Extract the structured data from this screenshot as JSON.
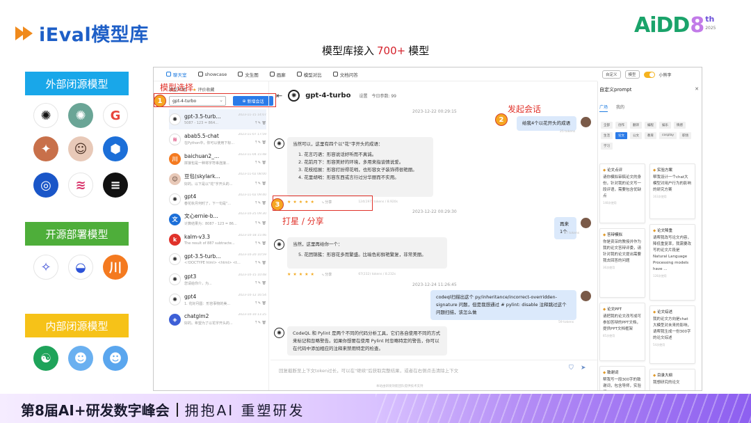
{
  "slide": {
    "title": "iEval模型库",
    "subtitle_pre": "模型库接入",
    "subtitle_count": "700+",
    "subtitle_post": "模型",
    "brand_word": "AiDD",
    "brand_num": "8",
    "brand_sup": "th",
    "brand_year": "2025",
    "accent": "#1e5fc7",
    "red": "#d4202a"
  },
  "categories": {
    "closed_external": "外部闭源模型",
    "open_deployed": "开源部署模型",
    "closed_internal": "内部闭源模型"
  },
  "logos": {
    "closed_external": [
      {
        "icon": "openai-icon",
        "glyph": "✺",
        "bg": "#ffffff",
        "fg": "#111111"
      },
      {
        "icon": "chatgpt-icon",
        "glyph": "✺",
        "bg": "#6aa596",
        "fg": "#ffffff"
      },
      {
        "icon": "google-icon",
        "glyph": "G",
        "bg": "#ffffff",
        "fg": "#e8453c"
      },
      {
        "icon": "claude-icon",
        "glyph": "✦",
        "bg": "#c8704a",
        "fg": "#ffffff"
      },
      {
        "icon": "avatar-girl-icon",
        "glyph": "☺",
        "bg": "#e8c9b8",
        "fg": "#4a3024"
      },
      {
        "icon": "hexagon-model-icon",
        "glyph": "⬢",
        "bg": "#1c6fd8",
        "fg": "#ffffff"
      },
      {
        "icon": "ring-model-icon",
        "glyph": "◎",
        "bg": "#1a56c8",
        "fg": "#ffffff"
      },
      {
        "icon": "wave-model-icon",
        "glyph": "≋",
        "bg": "#ffffff",
        "fg": "#d8336a"
      },
      {
        "icon": "stripe-model-icon",
        "glyph": "≡",
        "bg": "#111111",
        "fg": "#ffffff"
      }
    ],
    "open_deployed": [
      {
        "icon": "star-model-icon",
        "glyph": "✧",
        "bg": "#ffffff",
        "fg": "#3d4fd6"
      },
      {
        "icon": "whale-model-icon",
        "glyph": "◒",
        "bg": "#ffffff",
        "fg": "#2c52d8"
      },
      {
        "icon": "baichuan-icon",
        "glyph": "川",
        "bg": "#f47a20",
        "fg": "#ffffff"
      }
    ],
    "closed_internal": [
      {
        "icon": "leaf-model-icon",
        "glyph": "☯",
        "bg": "#1fa35a",
        "fg": "#ffffff"
      },
      {
        "icon": "robot-blue-icon",
        "glyph": "☻",
        "bg": "#6ab0f0",
        "fg": "#ffffff"
      },
      {
        "icon": "robot-blue-2-icon",
        "glyph": "☻",
        "bg": "#5aa6ee",
        "fg": "#ffffff"
      }
    ]
  },
  "app": {
    "nav": [
      {
        "label": "聊天室",
        "active": true
      },
      {
        "label": "showcase",
        "active": false
      },
      {
        "label": "文生图",
        "active": false
      },
      {
        "label": "画廊",
        "active": false
      },
      {
        "label": "模型对比",
        "active": false
      },
      {
        "label": "文档问答",
        "active": false
      }
    ],
    "top_right": {
      "chip1": "自定义",
      "chip2": "模型",
      "user": "小熊李"
    },
    "side_tabs": {
      "declare": "模型声明",
      "fav": "评价收藏"
    },
    "model_select": "gpt-4-turbo",
    "new_chat": "新增会话",
    "sessions": [
      {
        "name": "gpt-3.5-turb...",
        "time": "2023-11-15 14:07",
        "preview": "5087 - 123 = 864...",
        "color": "#ffffff",
        "glyph": "✺",
        "fg": "#222"
      },
      {
        "name": "abab5.5-chat",
        "time": "2023-11-07 17:59",
        "preview": "在Python中，你可以使用下标...",
        "color": "#ffffff",
        "glyph": "≋",
        "fg": "#d8336a"
      },
      {
        "name": "baichuan2_...",
        "time": "2023-11-04 15:48",
        "preview": "拼接包是一种将字符串连接...",
        "color": "#f47a20",
        "glyph": "川",
        "fg": "#fff"
      },
      {
        "name": "豆包(skylark...",
        "time": "2023-11-02 08:00",
        "preview": "好的。以下是以\"花\"字开头的...",
        "color": "#e8c9b8",
        "glyph": "☺",
        "fg": "#4a3024"
      },
      {
        "name": "gpt4",
        "time": "2023-11-02 09:40",
        "preview": "春花秋月何时了，下一句是\"...",
        "color": "#ffffff",
        "glyph": "✺",
        "fg": "#222"
      },
      {
        "name": "文心ernie-b...",
        "time": "2023-10-25 09:30",
        "preview": "计算结果为：8087 - 123 = 86...",
        "color": "#1c6fd8",
        "glyph": "文",
        "fg": "#fff"
      },
      {
        "name": "kalm-v3.3",
        "time": "2023-10-18 15:46",
        "preview": "The result of 887 subtracte...",
        "color": "#e0322a",
        "glyph": "k",
        "fg": "#fff"
      },
      {
        "name": "gpt-3.5-turb...",
        "time": "2023-10-20 10:59",
        "preview": "<!DOCTYPE html> <html> <t...",
        "color": "#ffffff",
        "glyph": "✺",
        "fg": "#222"
      },
      {
        "name": "gpt3",
        "time": "2023-10-15 10:48",
        "preview": "您请给你介，为...",
        "color": "#ffffff",
        "glyph": "✺",
        "fg": "#222"
      },
      {
        "name": "gpt4",
        "time": "2023-10-12 16:54",
        "preview": "1. 花好月圆：形容事物的美...",
        "color": "#ffffff",
        "glyph": "✺",
        "fg": "#222"
      },
      {
        "name": "chatglm2",
        "time": "2023-10-10 11:25",
        "preview": "好的。希望为了以花字开头的...",
        "color": "#3d5fd6",
        "glyph": "◈",
        "fg": "#fff"
      }
    ],
    "chat_title": "gpt-4-turbo",
    "chat_meta": "设置　今日参数: 99",
    "ts1": "2023-12-22 00:29:15",
    "user_msg1": "给我4个以花开头的成语",
    "tok1": "25 tokens",
    "bot_msg1_intro": "当然可以，这里有四个以\"花\"字开头的成语：",
    "bot_msg1_items": [
      "1. 花言巧语：形容说话好听而不真诚。",
      "2. 花前月下：形容美好的环境，多用来指谈情说爱。",
      "3. 花枝招展：形容打扮得花哨，也形容女子装饰得很艳丽。",
      "4. 花里胡哨：形容东西或言行过分华丽而不实用。"
    ],
    "share_label": "分享",
    "tok2": "124(197) tokens / 8.920s",
    "ts2": "2023-12-22 00:29:30",
    "user_msg2": "再来1个",
    "tok3": "17 tokens",
    "bot_msg2_intro": "当然，这里再给你一个：",
    "bot_msg2_item": "5. 花团锦簇：形容花多而繁盛。比喻色彩鲜艳繁复，非常美丽。",
    "tok4": "67(232) tokens / 8.232s",
    "ts3": "2023-12-24 11:26:45",
    "user_msg3": "codeql扫描出这个 py/inheritance/incorrect-overridden-signature 问题，但是我想通过 # pylint: disable 注释跳过这个问题扫描，该怎么做",
    "tok5": "59 tokens",
    "bot_msg3": "CodeQL 和 Pylint 是两个不同的代码分析工具，它们各自使用不同的方式来标记和忽略警告。如果你想要在使用 Pylint 时忽略特定的警告，你可以在代码中添加相应的注释来禁用特定的检查。",
    "input_placeholder": "回复截断至上下文token过长，可以在\"继续\"后获取完整结果，或者在右侧点击清除上下文",
    "footer_note": "本站由研发效能团队提供技术支持",
    "panel_title": "自定义prompt",
    "panel_tabs": [
      "广场",
      "我的"
    ],
    "tags": [
      "全部",
      "创作",
      "翻译",
      "编程",
      "娱乐",
      "情感",
      "生活",
      "论文",
      "公文",
      "教育",
      "cosplay",
      "职场",
      "学习"
    ],
    "active_tag": "论文",
    "cards": [
      {
        "title": "论文点评",
        "text": "请你模拟审稿论文的身份，针对我的论文写一段评语，需要包含优缺点",
        "count": "148次使用"
      },
      {
        "title": "实验方案",
        "text": "帮我设计一个chat大模型对用户行为的影响的研究方案",
        "count": "163次使用"
      },
      {
        "title": "答辩模拟",
        "text": "你是资深的教授并作为我的论文答辩评委，请针对我的论文提出需要我去回答的问题",
        "count": "36次使用"
      },
      {
        "title": "论文降重",
        "text": "请帮我改写论文内容，降低重复率，我需要改写的论文片段是 Natural Language Processing models have ...",
        "count": "128次使用"
      },
      {
        "title": "论文PPT",
        "text": "请把我的论文改写成可参加答辩的PPT文档，提供PPT文档框架",
        "count": "85次使用"
      },
      {
        "title": "论文综述",
        "text": "我的论文方向是chat大模型对未来的影响，请帮我生成一份300字的论文综述",
        "count": "54次使用"
      },
      {
        "title": "致谢词",
        "text": "帮我写一段300字的致谢词，包含导师，实验组",
        "count": ""
      },
      {
        "title": "目录大纲",
        "text": "我想研究的论文",
        "count": ""
      }
    ]
  },
  "annotations": {
    "a1_num": "1",
    "a1_text": "模型选择",
    "a2_num": "2",
    "a2_text": "发起会话",
    "a3_num": "3",
    "a3_text": "打星 / 分享"
  },
  "banner": {
    "event": "第8届AI+研发数字峰会",
    "slogan": "拥抱AI 重塑研发"
  }
}
